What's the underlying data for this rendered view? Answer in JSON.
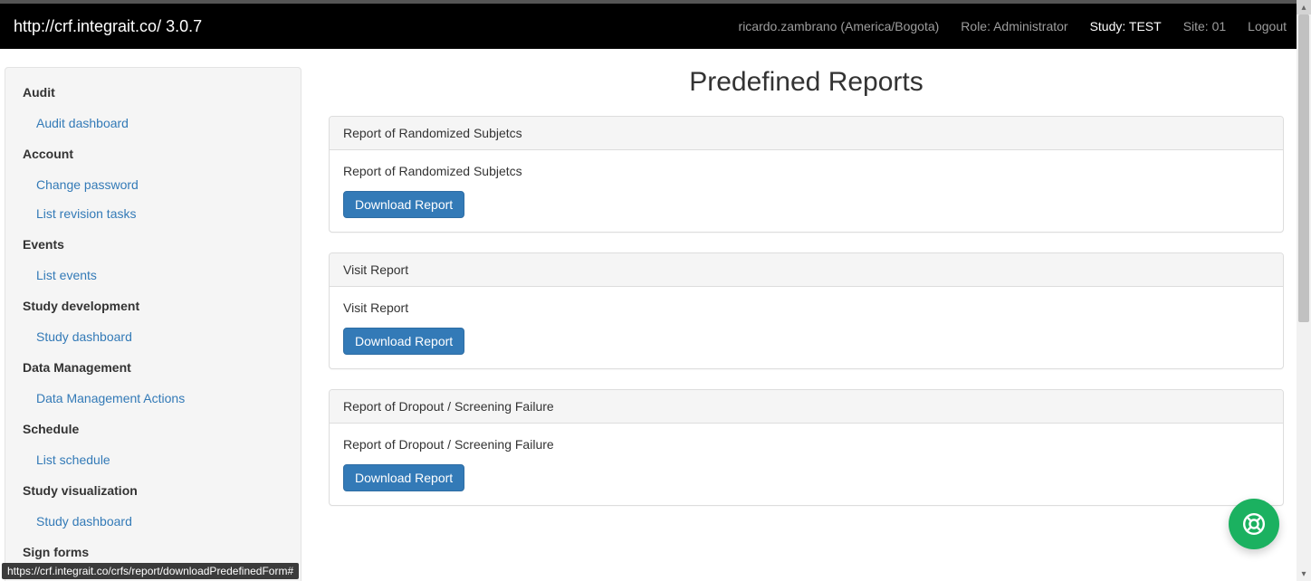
{
  "navbar": {
    "brand": "http://crf.integrait.co/ 3.0.7",
    "user": "ricardo.zambrano (America/Bogota)",
    "role": "Role: Administrator",
    "study": "Study: TEST",
    "site": "Site: 01",
    "logout": "Logout"
  },
  "sidebar": {
    "groups": [
      {
        "title": "Audit",
        "links": [
          "Audit dashboard"
        ]
      },
      {
        "title": "Account",
        "links": [
          "Change password",
          "List revision tasks"
        ]
      },
      {
        "title": "Events",
        "links": [
          "List events"
        ]
      },
      {
        "title": "Study development",
        "links": [
          "Study dashboard"
        ]
      },
      {
        "title": "Data Management",
        "links": [
          "Data Management Actions"
        ]
      },
      {
        "title": "Schedule",
        "links": [
          "List schedule"
        ]
      },
      {
        "title": "Study visualization",
        "links": [
          "Study dashboard"
        ]
      },
      {
        "title": "Sign forms",
        "links": []
      }
    ]
  },
  "page": {
    "title": "Predefined Reports",
    "download_label": "Download Report",
    "reports": [
      {
        "heading": "Report of Randomized Subjetcs",
        "body": "Report of Randomized Subjetcs"
      },
      {
        "heading": "Visit Report",
        "body": "Visit Report"
      },
      {
        "heading": "Report of Dropout / Screening Failure",
        "body": "Report of Dropout / Screening Failure"
      }
    ]
  },
  "status_url": "https://crf.integrait.co/crfs/report/downloadPredefinedForm#",
  "colors": {
    "primary": "#337ab7",
    "accent": "#1bb160"
  }
}
